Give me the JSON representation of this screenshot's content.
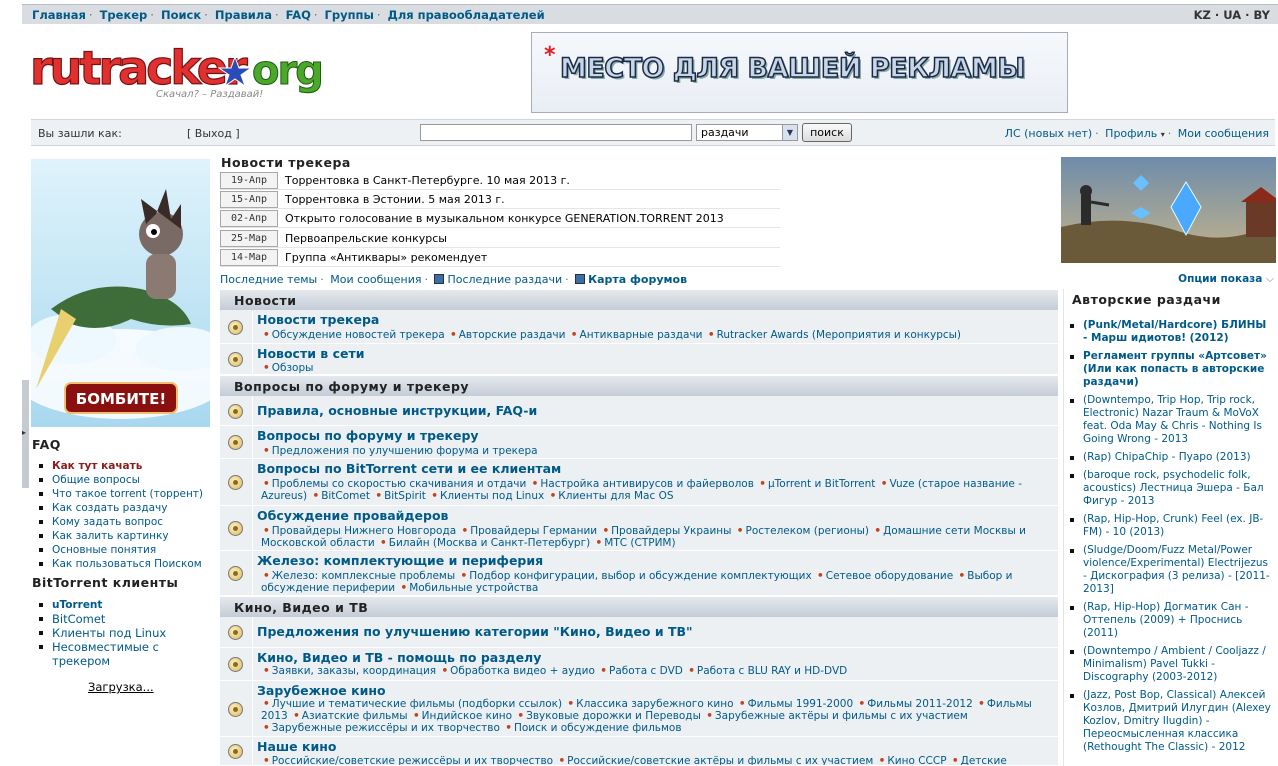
{
  "topnav": {
    "items": [
      "Главная",
      "Трекер",
      "Поиск",
      "Правила",
      "FAQ",
      "Группы",
      "Для правообладателей"
    ],
    "langs": "KZ · UA · BY"
  },
  "logo": {
    "text": "rutracker",
    "tld": "org",
    "slogan": "Скачал? – Раздавай!"
  },
  "banner": {
    "text": "МЕСТО ДЛЯ ВАШЕЙ РЕКЛАМЫ"
  },
  "loginbar": {
    "logged_as": "Вы зашли как:",
    "logout": "[ Выход ]",
    "search_value": "",
    "search_scope": "раздачи",
    "search_button": "поиск",
    "pm": "ЛС (новых нет)",
    "profile": "Профиль",
    "my_posts": "Мои сообщения"
  },
  "left_ad": {
    "button": "БОМБИТЕ!"
  },
  "faq": {
    "title": "FAQ",
    "items": [
      "Как тут качать",
      "Общие вопросы",
      "Что такое torrent (торрент)",
      "Как создать раздачу",
      "Кому задать вопрос",
      "Как залить картинку",
      "Основные понятия",
      "Как пользоваться Поиском"
    ]
  },
  "clients": {
    "title": "BitTorrent клиенты",
    "items": [
      "uTorrent",
      "BitComet",
      "Клиенты под Linux",
      "Несовместимые с трекером"
    ]
  },
  "upload": "Загрузка...",
  "news": {
    "title": "Новости трекера",
    "items": [
      {
        "date": "19-Апр",
        "title": "Торрентовка в Санкт-Петербурге. 10 мая 2013 г."
      },
      {
        "date": "15-Апр",
        "title": "Торрентовка в Эстонии. 5 мая 2013 г."
      },
      {
        "date": "02-Апр",
        "title": "Открыто голосование в музыкальном конкурсе GENERATION.TORRENT 2013"
      },
      {
        "date": "25-Мар",
        "title": "Первоапрельские конкурсы"
      },
      {
        "date": "14-Мар",
        "title": "Группа «Антиквары» рекомендует"
      }
    ]
  },
  "quicklinks": {
    "recent_topics": "Последние темы",
    "my_posts": "Мои сообщения",
    "recent_releases": "Последние раздачи",
    "forum_map": "Карта форумов"
  },
  "forums": {
    "cat1": "Новости",
    "f1": {
      "title": "Новости трекера",
      "subs": [
        "Обсуждение новостей трекера",
        "Авторские раздачи",
        "Антикварные раздачи",
        "Rutracker Awards (Мероприятия и конкурсы)"
      ]
    },
    "f2": {
      "title": "Новости в сети",
      "subs": [
        "Обзоры"
      ]
    },
    "cat2": "Вопросы по форуму и трекеру",
    "f3": {
      "title": "Правила, основные инструкции, FAQ-и"
    },
    "f4": {
      "title": "Вопросы по форуму и трекеру",
      "subs": [
        "Предложения по улучшению форума и трекера"
      ]
    },
    "f5": {
      "title": "Вопросы по BitTorrent сети и ее клиентам",
      "subs": [
        "Проблемы со скоростью скачивания и отдачи",
        "Настройка антивирусов и файерволов",
        "µTorrent и BitTorrent",
        "Vuze (старое название - Azureus)",
        "BitComet",
        "BitSpirit",
        "Клиенты под Linux",
        "Клиенты для Mac OS"
      ]
    },
    "f6": {
      "title": "Обсуждение провайдеров",
      "subs": [
        "Провайдеры Нижнего Новгорода",
        "Провайдеры Германии",
        "Провайдеры Украины",
        "Ростелеком (регионы)",
        "Домашние сети Москвы и Московской области",
        "Билайн (Москва и Санкт-Петербург)",
        "МТС (СТРИМ)"
      ]
    },
    "f7": {
      "title": "Железо: комплектующие и периферия",
      "subs": [
        "Железо: комплексные проблемы",
        "Подбор конфигурации, выбор и обсуждение комплектующих",
        "Сетевое оборудование",
        "Выбор и обсуждение периферии",
        "Мобильные устройства"
      ]
    },
    "cat3": "Кино, Видео и ТВ",
    "f8": {
      "title": "Предложения по улучшению категории \"Кино, Видео и ТВ\""
    },
    "f9": {
      "title": "Кино, Видео и ТВ - помощь по разделу",
      "subs": [
        "Заявки, заказы, координация",
        "Обработка видео + аудио",
        "Работа с DVD",
        "Работа с BLU RAY и HD-DVD"
      ]
    },
    "f10": {
      "title": "Зарубежное кино",
      "subs": [
        "Лучшие и тематические фильмы (подборки ссылок)",
        "Классика зарубежного кино",
        "Фильмы 1991-2000",
        "Фильмы 2011-2012",
        "Фильмы 2013",
        "Азиатские фильмы",
        "Индийское кино",
        "Звуковые дорожки и Переводы",
        "Зарубежные актёры и фильмы с их участием",
        "Зарубежные режиссёры и их творчество",
        "Поиск и обсуждение фильмов"
      ]
    },
    "f11": {
      "title": "Наше кино",
      "subs": [
        "Российские/советские режиссёры и их творчество",
        "Российские/советские актёры и фильмы с их участием",
        "Кино СССР",
        "Детские"
      ]
    }
  },
  "right": {
    "options": "Опции показа",
    "authors_title": "Авторские раздачи",
    "items": [
      "(Punk/Metal/Hardcore) БЛИНЫ - Марш идиотов! (2012)",
      "Регламент группы «Артсовет» (Или как попасть в авторские раздачи)",
      "(Downtempo, Trip Hop, Trip rock, Electronic) Nazar Traum & MoVoX feat. Oda May & Chris - Nothing Is Going Wrong - 2013",
      "(Rap) ChipaChip - Пуаро (2013)",
      "(baroque rock, psychodelic folk, acoustics) Лестница Эшера - Бал Фигур - 2013",
      "(Rap, Hip-Hop, Crunk) Feel (ex. JB-FM) - 10 (2013)",
      "(Sludge/Doom/Fuzz Metal/Power violence/Experimental) Electrijezus - Дискография (3 релиза) - [2011-2013]",
      "(Rap, Hip-Hop) Догматик Сан - Оттепель (2009) + Проснись (2011)",
      "(Downtempo / Ambient / Cooljazz / Minimalism) Pavel Tukki - Discography (2003-2012)",
      "(Jazz, Post Bop, Classical) Алексей Козлов, Дмитрий Илугдин (Alexey Kozlov, Dmitry Ilugdin) - Переосмысленная классика (Rethought The Classic) - 2012"
    ]
  }
}
